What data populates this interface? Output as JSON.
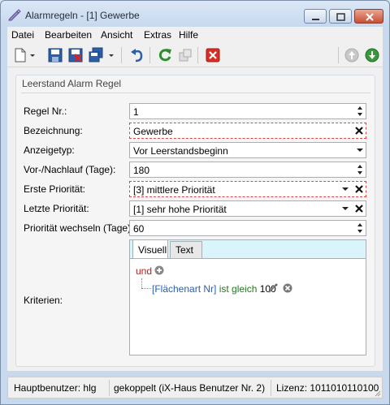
{
  "window": {
    "title": "Alarmregeln - [1] Gewerbe"
  },
  "menu": [
    "Datei",
    "Bearbeiten",
    "Ansicht",
    "Extras",
    "Hilfe"
  ],
  "group": {
    "title": "Leerstand Alarm Regel"
  },
  "form": {
    "regel_nr": {
      "label": "Regel Nr.:",
      "value": "1"
    },
    "bezeichnung": {
      "label": "Bezeichnung:",
      "value": "Gewerbe"
    },
    "anzeigetyp": {
      "label": "Anzeigetyp:",
      "value": "Vor Leerstandsbeginn"
    },
    "vor_nachlauf": {
      "label": "Vor-/Nachlauf (Tage):",
      "value": "180"
    },
    "erste_prioritaet": {
      "label": "Erste Priorität:",
      "value": "[3] mittlere Priorität"
    },
    "letzte_prioritaet": {
      "label": "Letzte Priorität:",
      "value": "[1] sehr hohe Priorität"
    },
    "prioritaet_wechseln": {
      "label": "Priorität wechseln (Tage):",
      "value": "60"
    },
    "kriterien": {
      "label": "Kriterien:"
    }
  },
  "tabs": [
    {
      "label": "Visuell",
      "active": true
    },
    {
      "label": "Text",
      "active": false
    }
  ],
  "criteria": {
    "operator": "und",
    "condition": {
      "field": "[Flächenart Nr]",
      "op": "ist gleich",
      "value": "100"
    }
  },
  "status": {
    "hauptbenutzer": "Hauptbenutzer: hlg",
    "gekoppelt": "gekoppelt (iX-Haus Benutzer Nr. 2)",
    "lizenz": "Lizenz: 1011010110100"
  },
  "colors": {
    "required_border": "#dd4444",
    "operator": "#b22222",
    "field": "#2a5db0",
    "op": "#1f7a1f"
  }
}
